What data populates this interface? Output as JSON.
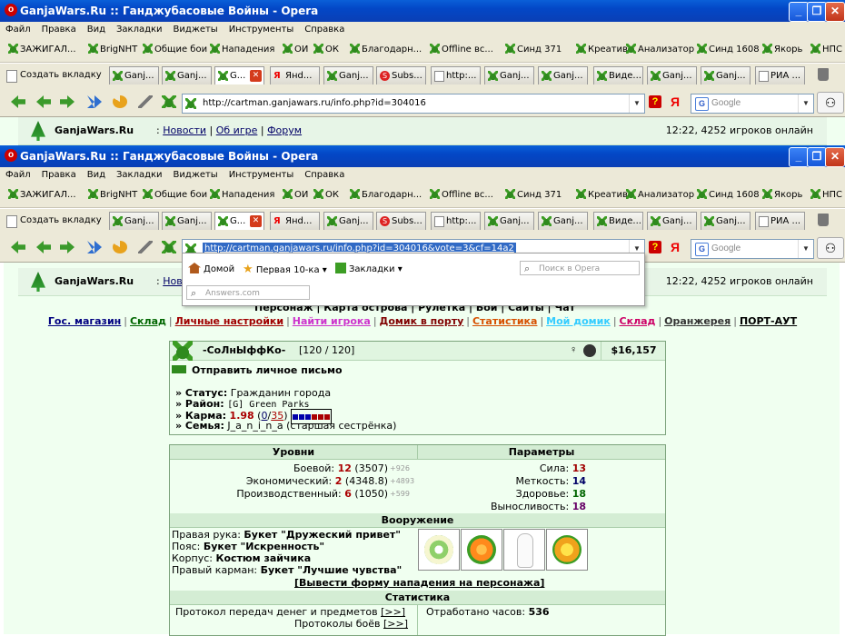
{
  "window": {
    "title": "GanjaWars.Ru :: Ганджубасовые Войны - Opera",
    "opera_logo": "o"
  },
  "menu": [
    "Файл",
    "Правка",
    "Вид",
    "Закладки",
    "Виджеты",
    "Инструменты",
    "Справка"
  ],
  "bookmarks": [
    "ЗАЖИГАЛ...",
    "BrigNHT",
    "Общие бои",
    "Нападения",
    "ОИ",
    "ОК",
    "Благодарн...",
    "Offline вс...",
    "Синд 371",
    "Креатив",
    "Анализатор",
    "Синд 1608",
    "Якорь",
    "НПС"
  ],
  "tabs": {
    "new_tab": "Создать вкладку",
    "items": [
      {
        "label": "Ganj...",
        "icon": "leaf"
      },
      {
        "label": "Ganj...",
        "icon": "leaf"
      },
      {
        "label": "G...",
        "icon": "leaf",
        "active": true
      },
      {
        "label": "Янd...",
        "icon": "yandex"
      },
      {
        "label": "Ganj...",
        "icon": "leaf"
      },
      {
        "label": "Subs...",
        "icon": "s"
      },
      {
        "label": "http:...",
        "icon": "page"
      },
      {
        "label": "Ganj...",
        "icon": "leaf"
      },
      {
        "label": "Ganj...",
        "icon": "leaf"
      },
      {
        "label": "Виде...",
        "icon": "leaf"
      },
      {
        "label": "Ganj...",
        "icon": "leaf"
      },
      {
        "label": "Ganj...",
        "icon": "leaf"
      },
      {
        "label": "РИА ...",
        "icon": "page"
      }
    ],
    "close_glyph": "✕"
  },
  "back_window": {
    "url": "http://cartman.ganjawars.ru/info.php?id=304016",
    "search_placeholder": "Google"
  },
  "front_window": {
    "url": "http://cartman.ganjawars.ru/info.php?id=304016&vote=3&cf=14a2",
    "search_placeholder": "Google"
  },
  "address_dropdown": {
    "home": "Домой",
    "top10": "Первая 10-ка",
    "bookmarks": "Закладки",
    "opera_search": "Поиск в Opera",
    "answers": "Answers.com"
  },
  "site_header": {
    "title": "GanjaWars.Ru",
    "colon": " : ",
    "links": [
      "Новости",
      "Об игре",
      "Форум"
    ],
    "links_short": "Новост",
    "status": "12:22, 4252 игроков онлайн"
  },
  "nav_menu1": "Персонаж | Карта острова | Рулетка | Бои | Сайты | Чат",
  "nav_menu2": [
    {
      "label": "Гос. магазин",
      "color": "#000080"
    },
    {
      "label": "Склад",
      "color": "#006600"
    },
    {
      "label": "Личные настройки",
      "color": "#a00000"
    },
    {
      "label": "Найти игрока",
      "color": "#cc33cc"
    },
    {
      "label": "Домик в порту",
      "color": "#800000"
    },
    {
      "label": "Статистика",
      "color": "#d65000"
    },
    {
      "label": "Мой домик",
      "color": "#33ccff"
    },
    {
      "label": "Склад",
      "color": "#cc0066"
    },
    {
      "label": "Оранжерея",
      "color": "#333333"
    },
    {
      "label": "ПОРТ-АУТ",
      "color": "#000000"
    }
  ],
  "profile": {
    "name": "-СоЛнЫффКо-",
    "hp": "[120 / 120]",
    "money": "$16,157",
    "send_message": "Отправить личное письмо",
    "status_label": "» Статус:",
    "status_value": "Гражданин города",
    "district_label": "» Район:",
    "district_value": "[G] Green Parks",
    "karma_label": "» Карма:",
    "karma_value": "1.98",
    "karma_votes_pos": "0",
    "karma_votes_total": "35",
    "family_label": "» Семья:",
    "family_value": "J_a_n_i_n_a (старшая сестрёнка)",
    "icons": [
      "gender-icon",
      "armor-icon"
    ]
  },
  "levels": {
    "header": "Уровни",
    "rows": [
      {
        "label": "Боевой:",
        "level": "12",
        "exp": "(3507)",
        "extra": "+926"
      },
      {
        "label": "Экономический:",
        "level": "2",
        "exp": "(4348.8)",
        "extra": "+4893"
      },
      {
        "label": "Производственный:",
        "level": "6",
        "exp": "(1050)",
        "extra": "+599"
      }
    ]
  },
  "params": {
    "header": "Параметры",
    "rows": [
      {
        "label": "Сила:",
        "value": "13",
        "color": "#a00000"
      },
      {
        "label": "Меткость:",
        "value": "14",
        "color": "#000066"
      },
      {
        "label": "Здоровье:",
        "value": "18",
        "color": "#006600"
      },
      {
        "label": "Выносливость:",
        "value": "18",
        "color": "#660066"
      }
    ]
  },
  "armament": {
    "header": "Вооружение",
    "rows": [
      {
        "label": "Правая рука:",
        "value": "Букет \"Дружеский привет\""
      },
      {
        "label": "Пояс:",
        "value": "Букет \"Искренность\""
      },
      {
        "label": "Корпус:",
        "value": "Костюм зайчика"
      },
      {
        "label": "Правый карман:",
        "value": "Букет \"Лучшие чувства\""
      }
    ],
    "attack_link": "[Вывести форму нападения на персонажа]"
  },
  "statistics": {
    "header": "Статистика",
    "transfers": "Протокол передач денег и предметов",
    "battles": "Протоколы боёв",
    "more": "[>>]",
    "hours_label": "Отработано часов:",
    "hours_value": "536"
  },
  "colors": {
    "title_blue": "#0a4fd0",
    "chrome": "#ece9d8",
    "page_green": "#f0fff0",
    "accent_red": "#c00000"
  }
}
